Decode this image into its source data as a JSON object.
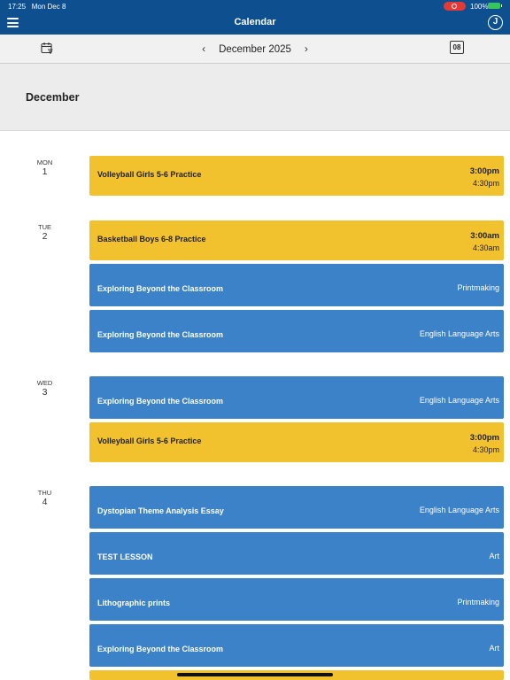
{
  "status_bar": {
    "time": "17:25",
    "date": "Mon Dec 8",
    "battery": "100%"
  },
  "app_bar": {
    "title": "Calendar",
    "avatar_initial": "J"
  },
  "toolbar": {
    "month_label": "December 2025",
    "prev": "‹",
    "next": "›",
    "today_label": "08"
  },
  "month_header": "December",
  "days": [
    {
      "dow": "MON",
      "num": "1",
      "events": [
        {
          "title": "Volleyball Girls 5-6 Practice",
          "start": "3:00pm",
          "end": "4:30pm"
        }
      ]
    },
    {
      "dow": "TUE",
      "num": "2",
      "events": [
        {
          "title": "Basketball Boys 6-8 Practice",
          "start": "3:00am",
          "end": "4:30am"
        },
        {
          "title": "Exploring Beyond the Classroom",
          "subject": "Printmaking"
        },
        {
          "title": "Exploring Beyond the Classroom",
          "subject": "English Language Arts"
        }
      ]
    },
    {
      "dow": "WED",
      "num": "3",
      "events": [
        {
          "title": "Exploring Beyond the Classroom",
          "subject": "English Language Arts"
        },
        {
          "title": "Volleyball Girls 5-6 Practice",
          "start": "3:00pm",
          "end": "4:30pm"
        }
      ]
    },
    {
      "dow": "THU",
      "num": "4",
      "events": [
        {
          "title": "Dystopian Theme Analysis Essay",
          "subject": "English Language Arts"
        },
        {
          "title": "TEST LESSON",
          "subject": "Art"
        },
        {
          "title": "Lithographic prints",
          "subject": "Printmaking"
        },
        {
          "title": "Exploring Beyond the Classroom",
          "subject": "Art"
        }
      ]
    }
  ],
  "colors": {
    "app_bar": "#0d4f8f",
    "sport_event": "#f2c12e",
    "lesson_event": "#3b82c8"
  }
}
